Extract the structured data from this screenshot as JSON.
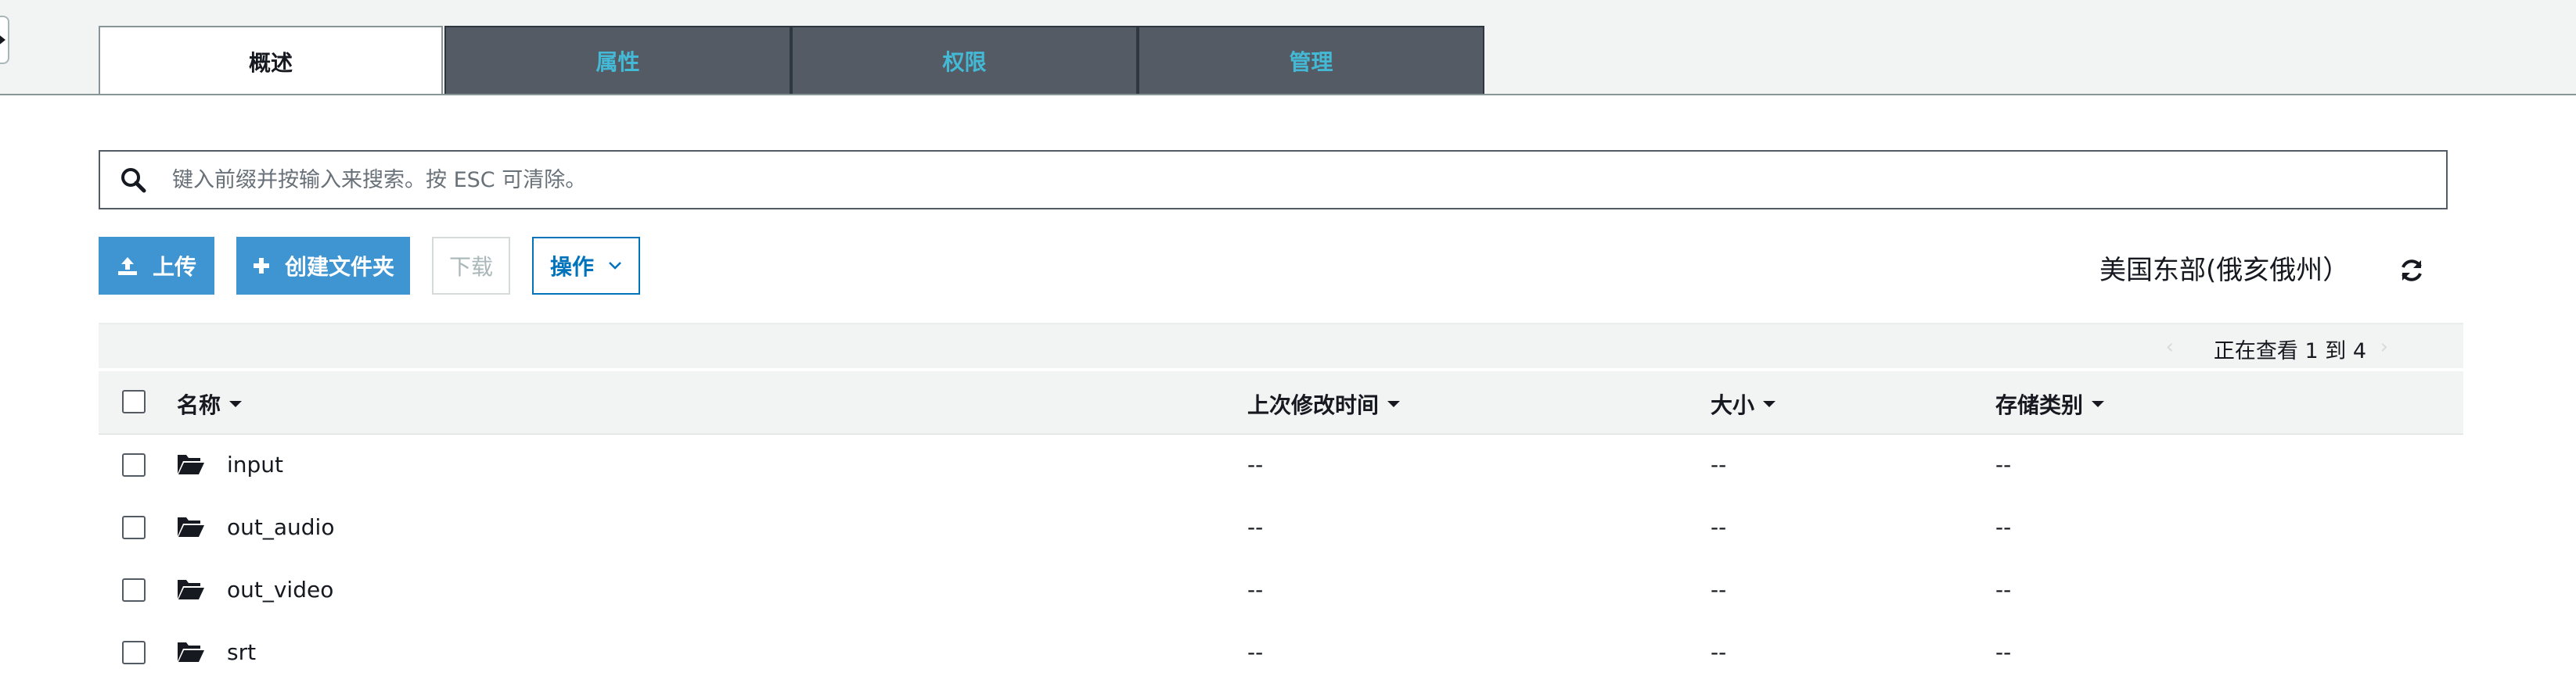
{
  "tabs": [
    {
      "label": "概述",
      "active": true
    },
    {
      "label": "属性",
      "active": false
    },
    {
      "label": "权限",
      "active": false
    },
    {
      "label": "管理",
      "active": false
    }
  ],
  "search": {
    "placeholder": "键入前缀并按输入来搜索。按 ESC 可清除。",
    "icon": "search-icon"
  },
  "toolbar": {
    "upload_label": "上传",
    "create_folder_label": "创建文件夹",
    "download_label": "下载",
    "actions_label": "操作"
  },
  "region": "美国东部(俄亥俄州）",
  "pager": {
    "text": "正在查看 1 到 4",
    "prev": "‹",
    "next": "›"
  },
  "table": {
    "columns": [
      "名称",
      "上次修改时间",
      "大小",
      "存储类别"
    ],
    "rows": [
      {
        "name": "input",
        "modified": "--",
        "size": "--",
        "storage": "--"
      },
      {
        "name": "out_audio",
        "modified": "--",
        "size": "--",
        "storage": "--"
      },
      {
        "name": "out_video",
        "modified": "--",
        "size": "--",
        "storage": "--"
      },
      {
        "name": "srt",
        "modified": "--",
        "size": "--",
        "storage": "--"
      }
    ]
  },
  "colors": {
    "tab_bg": "#545b64",
    "tab_text": "#44b9d6",
    "primary_button": "#3e95d1",
    "link": "#0073bb"
  }
}
